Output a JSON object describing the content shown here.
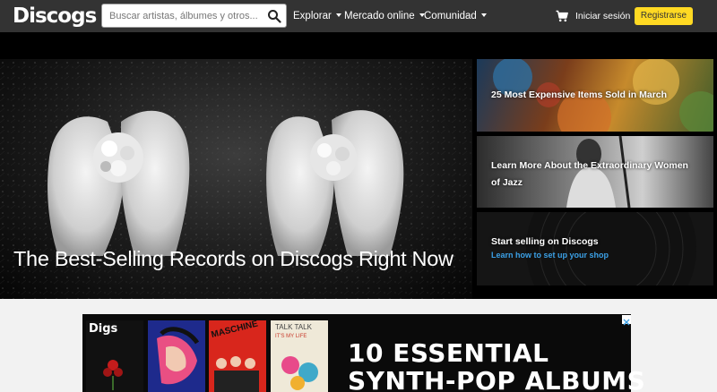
{
  "header": {
    "logo": "Discogs",
    "search_placeholder": "Buscar artistas, álbumes y otros...",
    "nav": [
      {
        "label": "Explorar"
      },
      {
        "label": "Mercado online"
      },
      {
        "label": "Comunidad"
      }
    ],
    "login_label": "Iniciar sesión",
    "register_label": "Registrarse"
  },
  "hero": {
    "title": "The Best-Selling Records on Discogs Right Now"
  },
  "side_cards": [
    {
      "title": "25 Most Expensive Items Sold in March"
    },
    {
      "title": "Learn More About the Extraordinary Women of Jazz"
    },
    {
      "title": "Start selling on Discogs",
      "link": "Learn how to set up your shop"
    }
  ],
  "ad": {
    "brand": "Digs",
    "headline_line1": "10 ESSENTIAL",
    "headline_line2": "SYNTH-POP ALBUMS",
    "album_texts": [
      "MASCHINE",
      "TALK TALK",
      "IT'S MY LIFE"
    ]
  },
  "colors": {
    "header_bg": "#333333",
    "register_button": "#ffd923",
    "link_blue": "#3ba0e6"
  }
}
